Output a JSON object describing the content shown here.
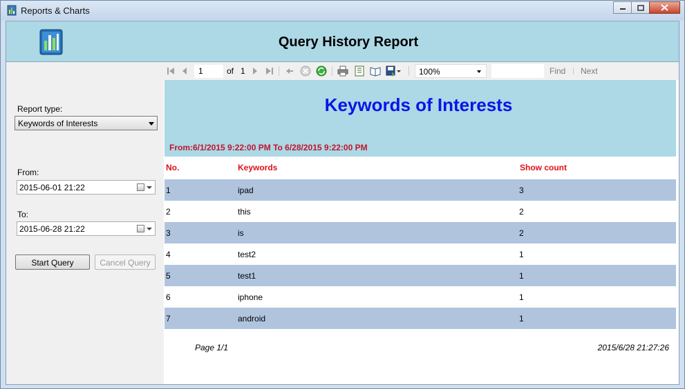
{
  "window": {
    "title": "Reports & Charts"
  },
  "header": {
    "title": "Query History Report"
  },
  "sidebar": {
    "report_type_label": "Report type:",
    "report_type_value": "Keywords of Interests",
    "from_label": "From:",
    "from_value": "2015-06-01 21:22",
    "to_label": "To:",
    "to_value": "2015-06-28 21:22",
    "start_button": "Start Query",
    "cancel_button": "Cancel Query"
  },
  "toolbar": {
    "page_value": "1",
    "of_label": "of",
    "total_pages": "1",
    "zoom": "100%",
    "find_label": "Find",
    "next_label": "Next"
  },
  "report": {
    "title": "Keywords of Interests",
    "range": "From:6/1/2015 9:22:00 PM To 6/28/2015 9:22:00 PM",
    "columns": [
      "No.",
      "Keywords",
      "Show count"
    ],
    "rows": [
      [
        "1",
        "ipad",
        "3"
      ],
      [
        "2",
        "this",
        "2"
      ],
      [
        "3",
        "is",
        "2"
      ],
      [
        "4",
        "test2",
        "1"
      ],
      [
        "5",
        "test1",
        "1"
      ],
      [
        "6",
        "iphone",
        "1"
      ],
      [
        "7",
        "android",
        "1"
      ]
    ],
    "footer_page": "Page 1/1",
    "footer_timestamp": "2015/6/28 21:27:26"
  },
  "colors": {
    "header_bg": "#add8e6",
    "row_alt_bg": "#b0c4de",
    "report_title": "#0a14e6",
    "accent_red": "#e0101a"
  }
}
